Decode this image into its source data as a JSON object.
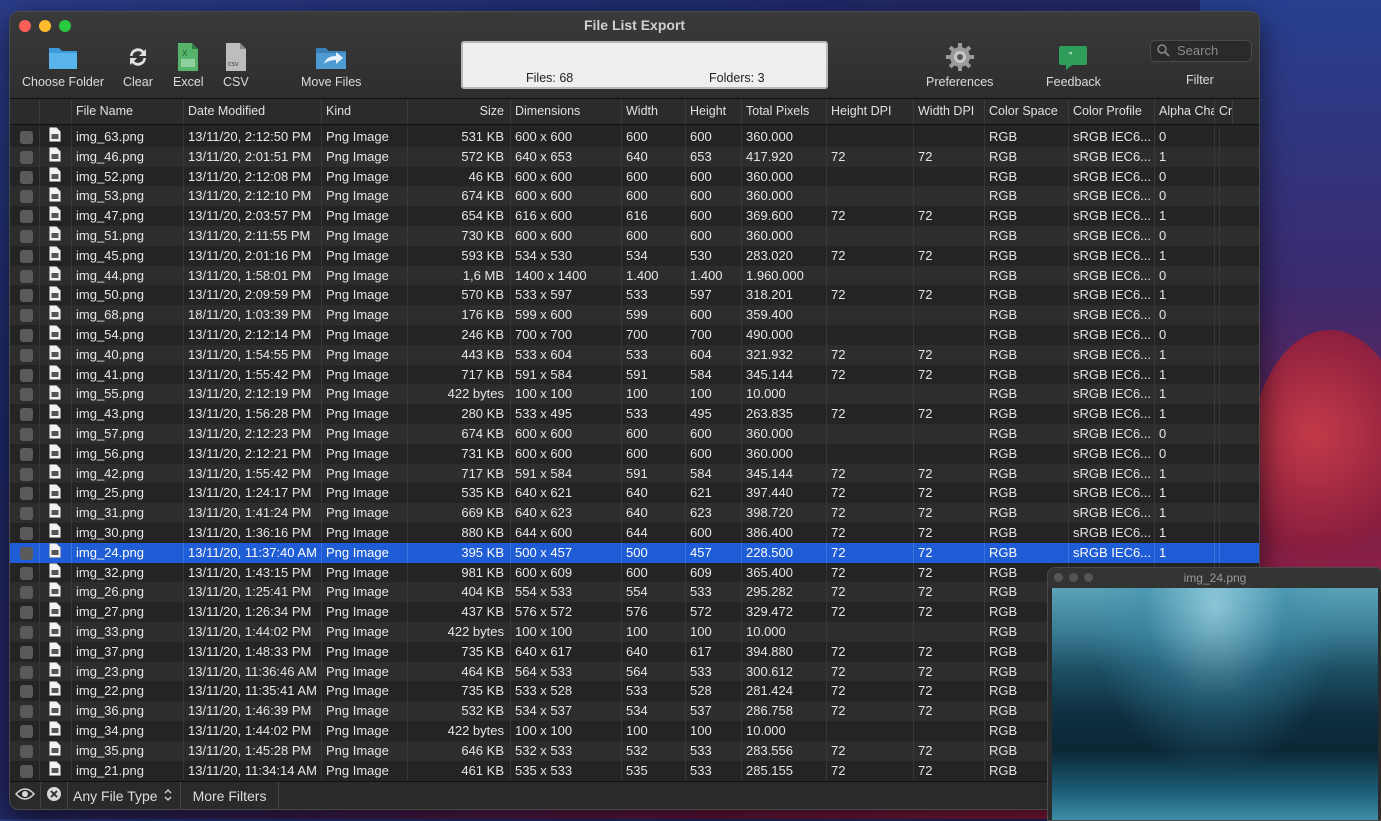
{
  "window": {
    "title": "File List Export"
  },
  "toolbar": {
    "choose_folder": "Choose Folder",
    "clear": "Clear",
    "excel": "Excel",
    "csv": "CSV",
    "move_files": "Move Files",
    "preferences": "Preferences",
    "feedback": "Feedback",
    "filter": "Filter",
    "search_placeholder": "Search"
  },
  "counter": {
    "files": "Files: 68",
    "folders": "Folders: 3"
  },
  "columns": [
    "File Name",
    "Date Modified",
    "Kind",
    "Size",
    "Dimensions",
    "Width",
    "Height",
    "Total Pixels",
    "Height DPI",
    "Width DPI",
    "Color Space",
    "Color Profile",
    "Alpha Chan...",
    "Cr"
  ],
  "rows": [
    [
      "img_63.png",
      "13/11/20, 2:12:50 PM",
      "Png Image",
      "531 KB",
      "600 x 600",
      "600",
      "600",
      "360.000",
      "",
      "",
      "RGB",
      "sRGB IEC6...",
      "0"
    ],
    [
      "img_46.png",
      "13/11/20, 2:01:51 PM",
      "Png Image",
      "572 KB",
      "640 x 653",
      "640",
      "653",
      "417.920",
      "72",
      "72",
      "RGB",
      "sRGB IEC6...",
      "1"
    ],
    [
      "img_52.png",
      "13/11/20, 2:12:08 PM",
      "Png Image",
      "46 KB",
      "600 x 600",
      "600",
      "600",
      "360.000",
      "",
      "",
      "RGB",
      "sRGB IEC6...",
      "0"
    ],
    [
      "img_53.png",
      "13/11/20, 2:12:10 PM",
      "Png Image",
      "674 KB",
      "600 x 600",
      "600",
      "600",
      "360.000",
      "",
      "",
      "RGB",
      "sRGB IEC6...",
      "0"
    ],
    [
      "img_47.png",
      "13/11/20, 2:03:57 PM",
      "Png Image",
      "654 KB",
      "616 x 600",
      "616",
      "600",
      "369.600",
      "72",
      "72",
      "RGB",
      "sRGB IEC6...",
      "1"
    ],
    [
      "img_51.png",
      "13/11/20, 2:11:55 PM",
      "Png Image",
      "730 KB",
      "600 x 600",
      "600",
      "600",
      "360.000",
      "",
      "",
      "RGB",
      "sRGB IEC6...",
      "0"
    ],
    [
      "img_45.png",
      "13/11/20, 2:01:16 PM",
      "Png Image",
      "593 KB",
      "534 x 530",
      "534",
      "530",
      "283.020",
      "72",
      "72",
      "RGB",
      "sRGB IEC6...",
      "1"
    ],
    [
      "img_44.png",
      "13/11/20, 1:58:01 PM",
      "Png Image",
      "1,6 MB",
      "1400 x 1400",
      "1.400",
      "1.400",
      "1.960.000",
      "",
      "",
      "RGB",
      "sRGB IEC6...",
      "0"
    ],
    [
      "img_50.png",
      "13/11/20, 2:09:59 PM",
      "Png Image",
      "570 KB",
      "533 x 597",
      "533",
      "597",
      "318.201",
      "72",
      "72",
      "RGB",
      "sRGB IEC6...",
      "1"
    ],
    [
      "img_68.png",
      "18/11/20, 1:03:39 PM",
      "Png Image",
      "176 KB",
      "599 x 600",
      "599",
      "600",
      "359.400",
      "",
      "",
      "RGB",
      "sRGB IEC6...",
      "0"
    ],
    [
      "img_54.png",
      "13/11/20, 2:12:14 PM",
      "Png Image",
      "246 KB",
      "700 x 700",
      "700",
      "700",
      "490.000",
      "",
      "",
      "RGB",
      "sRGB IEC6...",
      "0"
    ],
    [
      "img_40.png",
      "13/11/20, 1:54:55 PM",
      "Png Image",
      "443 KB",
      "533 x 604",
      "533",
      "604",
      "321.932",
      "72",
      "72",
      "RGB",
      "sRGB IEC6...",
      "1"
    ],
    [
      "img_41.png",
      "13/11/20, 1:55:42 PM",
      "Png Image",
      "717 KB",
      "591 x 584",
      "591",
      "584",
      "345.144",
      "72",
      "72",
      "RGB",
      "sRGB IEC6...",
      "1"
    ],
    [
      "img_55.png",
      "13/11/20, 2:12:19 PM",
      "Png Image",
      "422 bytes",
      "100 x 100",
      "100",
      "100",
      "10.000",
      "",
      "",
      "RGB",
      "sRGB IEC6...",
      "1"
    ],
    [
      "img_43.png",
      "13/11/20, 1:56:28 PM",
      "Png Image",
      "280 KB",
      "533 x 495",
      "533",
      "495",
      "263.835",
      "72",
      "72",
      "RGB",
      "sRGB IEC6...",
      "1"
    ],
    [
      "img_57.png",
      "13/11/20, 2:12:23 PM",
      "Png Image",
      "674 KB",
      "600 x 600",
      "600",
      "600",
      "360.000",
      "",
      "",
      "RGB",
      "sRGB IEC6...",
      "0"
    ],
    [
      "img_56.png",
      "13/11/20, 2:12:21 PM",
      "Png Image",
      "731 KB",
      "600 x 600",
      "600",
      "600",
      "360.000",
      "",
      "",
      "RGB",
      "sRGB IEC6...",
      "0"
    ],
    [
      "img_42.png",
      "13/11/20, 1:55:42 PM",
      "Png Image",
      "717 KB",
      "591 x 584",
      "591",
      "584",
      "345.144",
      "72",
      "72",
      "RGB",
      "sRGB IEC6...",
      "1"
    ],
    [
      "img_25.png",
      "13/11/20, 1:24:17 PM",
      "Png Image",
      "535 KB",
      "640 x 621",
      "640",
      "621",
      "397.440",
      "72",
      "72",
      "RGB",
      "sRGB IEC6...",
      "1"
    ],
    [
      "img_31.png",
      "13/11/20, 1:41:24 PM",
      "Png Image",
      "669 KB",
      "640 x 623",
      "640",
      "623",
      "398.720",
      "72",
      "72",
      "RGB",
      "sRGB IEC6...",
      "1"
    ],
    [
      "img_30.png",
      "13/11/20, 1:36:16 PM",
      "Png Image",
      "880 KB",
      "644 x 600",
      "644",
      "600",
      "386.400",
      "72",
      "72",
      "RGB",
      "sRGB IEC6...",
      "1"
    ],
    [
      "img_24.png",
      "13/11/20, 11:37:40 AM",
      "Png Image",
      "395 KB",
      "500 x 457",
      "500",
      "457",
      "228.500",
      "72",
      "72",
      "RGB",
      "sRGB IEC6...",
      "1"
    ],
    [
      "img_32.png",
      "13/11/20, 1:43:15 PM",
      "Png Image",
      "981 KB",
      "600 x 609",
      "600",
      "609",
      "365.400",
      "72",
      "72",
      "RGB",
      "",
      ""
    ],
    [
      "img_26.png",
      "13/11/20, 1:25:41 PM",
      "Png Image",
      "404 KB",
      "554 x 533",
      "554",
      "533",
      "295.282",
      "72",
      "72",
      "RGB",
      "",
      ""
    ],
    [
      "img_27.png",
      "13/11/20, 1:26:34 PM",
      "Png Image",
      "437 KB",
      "576 x 572",
      "576",
      "572",
      "329.472",
      "72",
      "72",
      "RGB",
      "",
      ""
    ],
    [
      "img_33.png",
      "13/11/20, 1:44:02 PM",
      "Png Image",
      "422 bytes",
      "100 x 100",
      "100",
      "100",
      "10.000",
      "",
      "",
      "RGB",
      "",
      ""
    ],
    [
      "img_37.png",
      "13/11/20, 1:48:33 PM",
      "Png Image",
      "735 KB",
      "640 x 617",
      "640",
      "617",
      "394.880",
      "72",
      "72",
      "RGB",
      "",
      ""
    ],
    [
      "img_23.png",
      "13/11/20, 11:36:46 AM",
      "Png Image",
      "464 KB",
      "564 x 533",
      "564",
      "533",
      "300.612",
      "72",
      "72",
      "RGB",
      "",
      ""
    ],
    [
      "img_22.png",
      "13/11/20, 11:35:41 AM",
      "Png Image",
      "735 KB",
      "533 x 528",
      "533",
      "528",
      "281.424",
      "72",
      "72",
      "RGB",
      "",
      ""
    ],
    [
      "img_36.png",
      "13/11/20, 1:46:39 PM",
      "Png Image",
      "532 KB",
      "534 x 537",
      "534",
      "537",
      "286.758",
      "72",
      "72",
      "RGB",
      "",
      ""
    ],
    [
      "img_34.png",
      "13/11/20, 1:44:02 PM",
      "Png Image",
      "422 bytes",
      "100 x 100",
      "100",
      "100",
      "10.000",
      "",
      "",
      "RGB",
      "",
      ""
    ],
    [
      "img_35.png",
      "13/11/20, 1:45:28 PM",
      "Png Image",
      "646 KB",
      "532 x 533",
      "532",
      "533",
      "283.556",
      "72",
      "72",
      "RGB",
      "",
      ""
    ],
    [
      "img_21.png",
      "13/11/20, 11:34:14 AM",
      "Png Image",
      "461 KB",
      "535 x 533",
      "535",
      "533",
      "285.155",
      "72",
      "72",
      "RGB",
      "",
      ""
    ]
  ],
  "selected_row": "img_24.png",
  "bottombar": {
    "file_type": "Any File Type",
    "more_filters": "More Filters"
  },
  "preview": {
    "title": "img_24.png"
  },
  "colors": {
    "selection": "#1f5dd6",
    "window_bg": "#242424",
    "accent_feedback": "#2f9e5a"
  }
}
